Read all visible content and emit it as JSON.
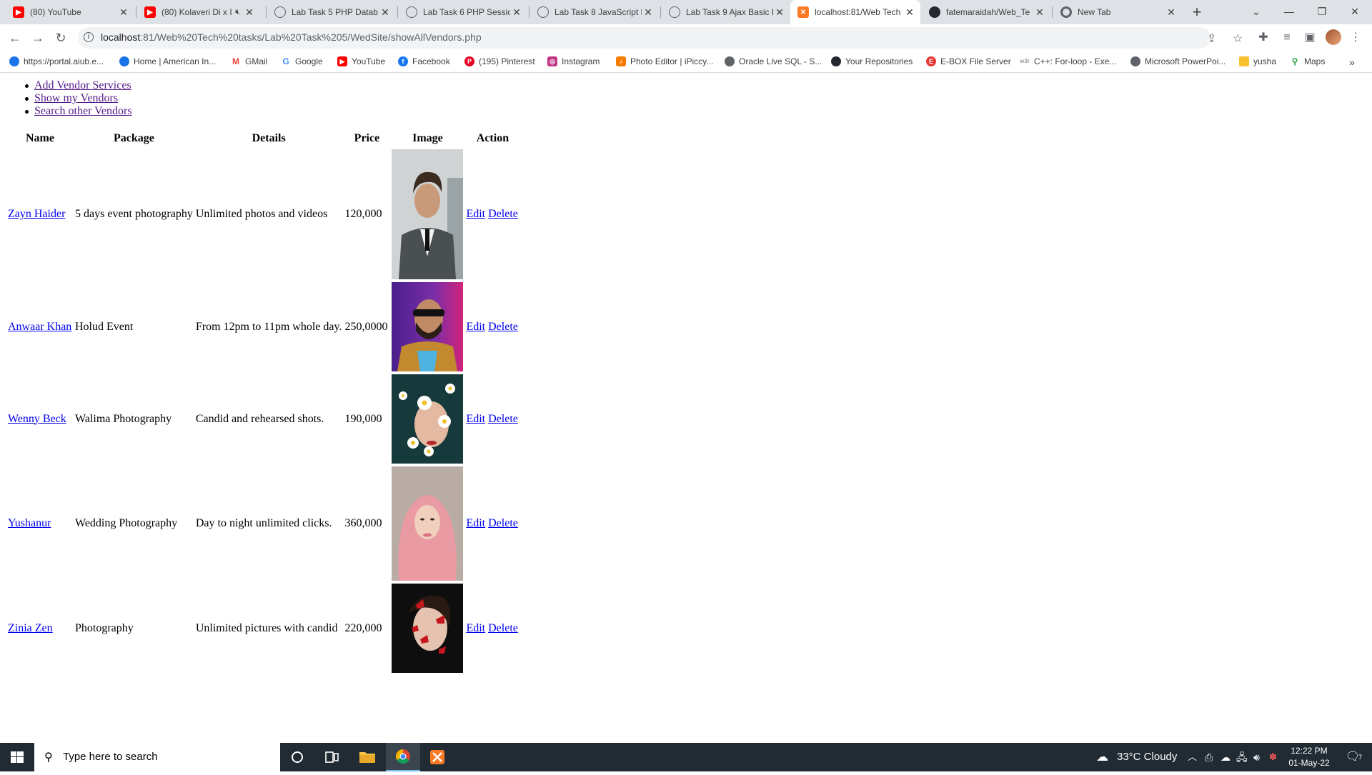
{
  "tabs": [
    {
      "title": "(80) YouTube",
      "icon": "youtube-icon"
    },
    {
      "title": "(80) Kolaveri Di x I",
      "icon": "youtube-icon"
    },
    {
      "title": "Lab Task 5 PHP Datab",
      "icon": "globe-icon"
    },
    {
      "title": "Lab Task 6 PHP Sessio",
      "icon": "globe-icon"
    },
    {
      "title": "Lab Task 8 JavaScript F",
      "icon": "globe-icon"
    },
    {
      "title": "Lab Task 9 Ajax Basic F",
      "icon": "globe-icon"
    },
    {
      "title": "localhost:81/Web Tech",
      "icon": "xampp-icon"
    },
    {
      "title": "fatemaraidah/Web_Te",
      "icon": "github-icon"
    },
    {
      "title": "New Tab",
      "icon": "chrome-icon"
    }
  ],
  "address": {
    "host": "localhost",
    "path": ":81/Web%20Tech%20tasks/Lab%20Task%205/WedSite/showAllVendors.php"
  },
  "bookmarks": [
    {
      "label": "https://portal.aiub.e...",
      "color": "#1a73e8"
    },
    {
      "label": "Home | American In...",
      "color": "#1a73e8"
    },
    {
      "label": "GMail",
      "color": "#ea4335"
    },
    {
      "label": "Google",
      "color": "#4285f4"
    },
    {
      "label": "YouTube",
      "color": "#ff0000"
    },
    {
      "label": "Facebook",
      "color": "#1877f2"
    },
    {
      "label": "(195) Pinterest",
      "color": "#e60023"
    },
    {
      "label": "Instagram",
      "color": "#c13584"
    },
    {
      "label": "Photo Editor | iPiccy...",
      "color": "#f57c00"
    },
    {
      "label": "Oracle Live SQL - S...",
      "color": "#5f6368"
    },
    {
      "label": "Your Repositories",
      "color": "#24292f"
    },
    {
      "label": "E-BOX File Server",
      "color": "#e53935"
    },
    {
      "label": "C++: For-loop - Exe...",
      "color": "#9e9e9e"
    },
    {
      "label": "Microsoft PowerPoi...",
      "color": "#5f6368"
    },
    {
      "label": "yusha",
      "color": "#fbc02d"
    },
    {
      "label": "Maps",
      "color": "#34a853"
    }
  ],
  "page": {
    "nav": [
      "Add Vendor Services",
      "Show my Vendors",
      "Search other Vendors"
    ],
    "table": {
      "headers": [
        "Name",
        "Package",
        "Details",
        "Price",
        "Image",
        "Action"
      ],
      "rows": [
        {
          "name": "Zayn Haider",
          "package": "5 days event photography",
          "details": "Unlimited photos and videos",
          "price": "120,000",
          "edit": "Edit",
          "delete": "Delete",
          "image": "portrait of man in grey suit"
        },
        {
          "name": "Anwaar Khan",
          "package": "Holud Event",
          "details": "From 12pm to 11pm whole day.",
          "price": "250,0000",
          "edit": "Edit",
          "delete": "Delete",
          "image": "man with sunglasses on purple background"
        },
        {
          "name": "Wenny Beck",
          "package": "Walima Photography",
          "details": "Candid and rehearsed shots.",
          "price": "190,000",
          "edit": "Edit",
          "delete": "Delete",
          "image": "woman with daisies"
        },
        {
          "name": "Yushanur",
          "package": "Wedding Photography",
          "details": "Day to night unlimited clicks.",
          "price": "360,000",
          "edit": "Edit",
          "delete": "Delete",
          "image": "woman in pink hijab"
        },
        {
          "name": "Zinia Zen",
          "package": "Photography",
          "details": "Unlimited pictures with candid",
          "price": "220,000",
          "edit": "Edit",
          "delete": "Delete",
          "image": "woman with red butterflies"
        }
      ]
    }
  },
  "taskbar": {
    "search_placeholder": "Type here to search",
    "weather": "33°C  Cloudy",
    "time": "12:22 PM",
    "date": "01-May-22",
    "notification_count": "7"
  }
}
